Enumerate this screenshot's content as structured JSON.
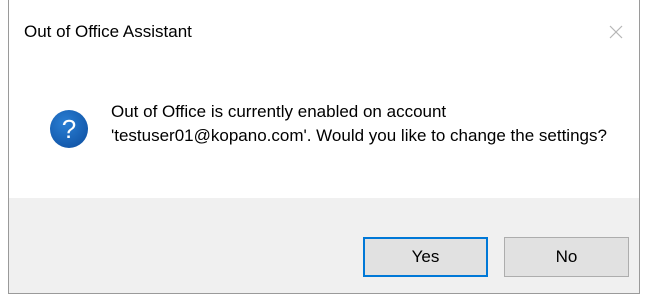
{
  "dialog": {
    "title": "Out of Office Assistant",
    "message": "Out of Office is currently enabled on account 'testuser01@kopano.com'. Would you like to change the settings?",
    "icon": "question-icon",
    "close_icon": "close-icon"
  },
  "buttons": {
    "yes_label": "Yes",
    "no_label": "No"
  },
  "colors": {
    "icon_blue": "#1565c0",
    "focus_border": "#0078d7",
    "footer_bg": "#f0f0f0",
    "button_bg": "#e1e1e1"
  }
}
